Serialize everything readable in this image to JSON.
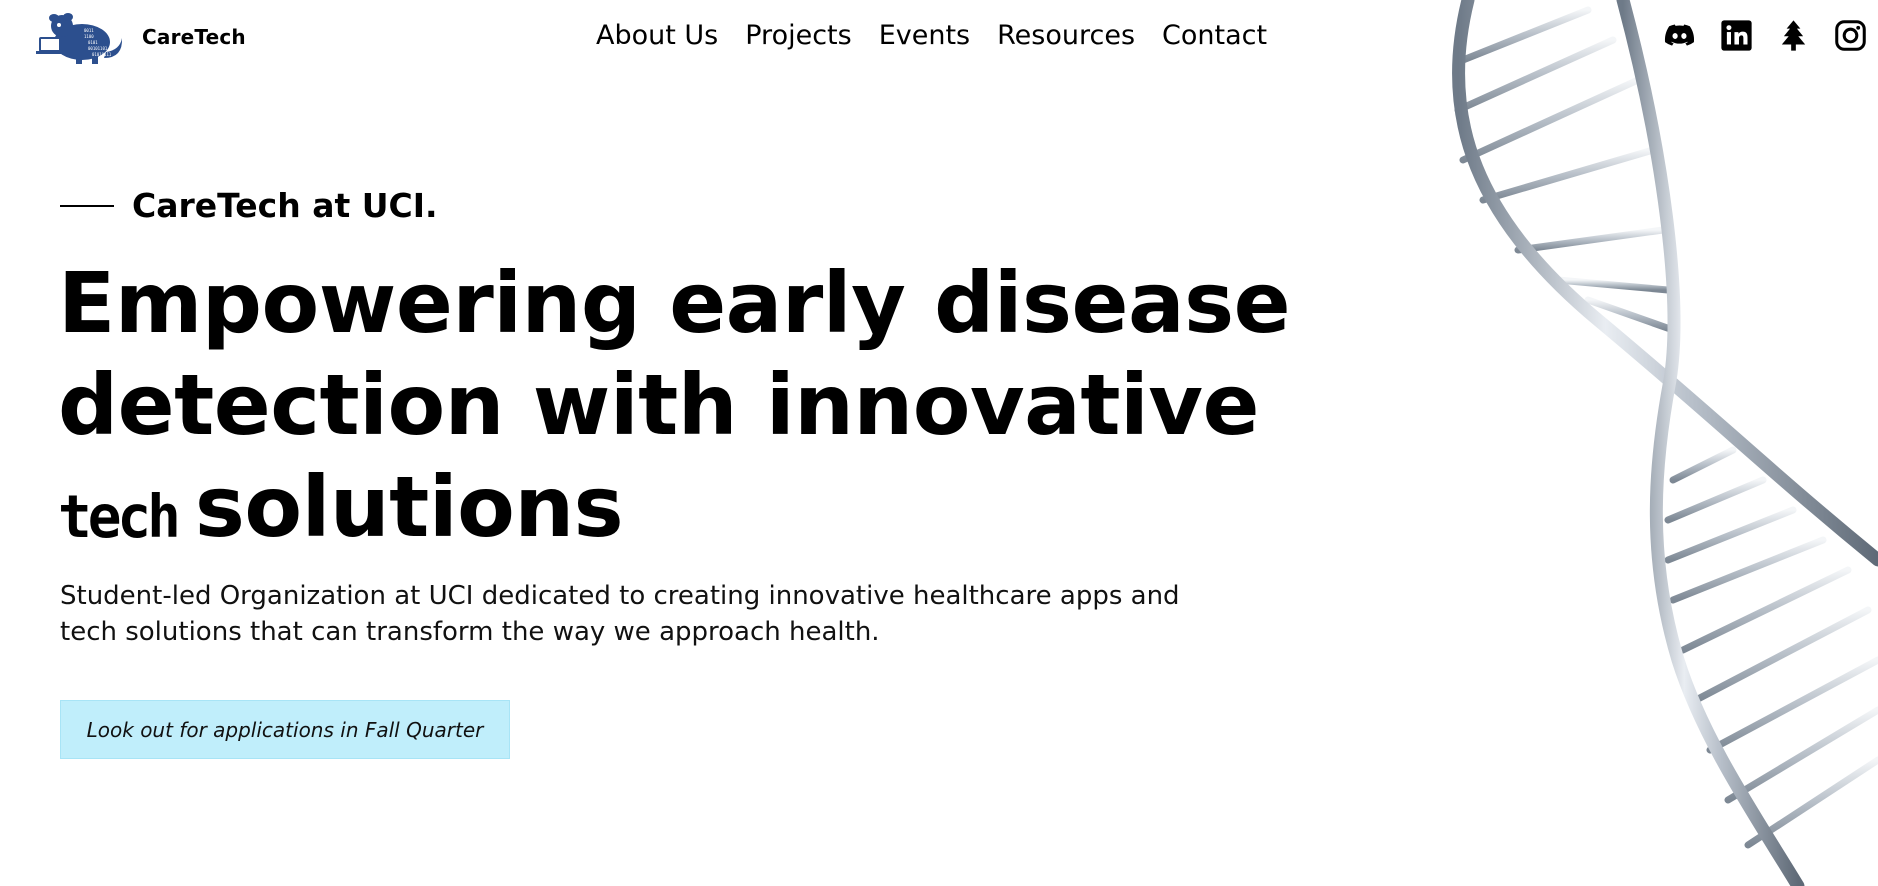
{
  "brand": {
    "name": "CareTech",
    "logo_lettering": "0011 1100 0101 00101101 01010111"
  },
  "nav": {
    "items": [
      {
        "label": "About Us"
      },
      {
        "label": "Projects"
      },
      {
        "label": "Events"
      },
      {
        "label": "Resources"
      },
      {
        "label": "Contact"
      }
    ]
  },
  "socials": [
    "discord-icon",
    "linkedin-icon",
    "linktree-icon",
    "instagram-icon"
  ],
  "hero": {
    "eyebrow": "CareTech at UCI.",
    "headline_line1": "Empowering early disease",
    "headline_line2": "detection with innovative",
    "headline_tech": "tech",
    "headline_line3": "solutions",
    "description": "Student-led Organization at UCI dedicated to creating innovative healthcare apps and tech solutions that can transform the way we approach health.",
    "cta_label": "Look out for applications in Fall Quarter"
  },
  "colors": {
    "cta_background": "#c0eefb",
    "text": "#000000",
    "logo_blue": "#2c4f8e",
    "dna_steel": "#9aa4b0"
  }
}
